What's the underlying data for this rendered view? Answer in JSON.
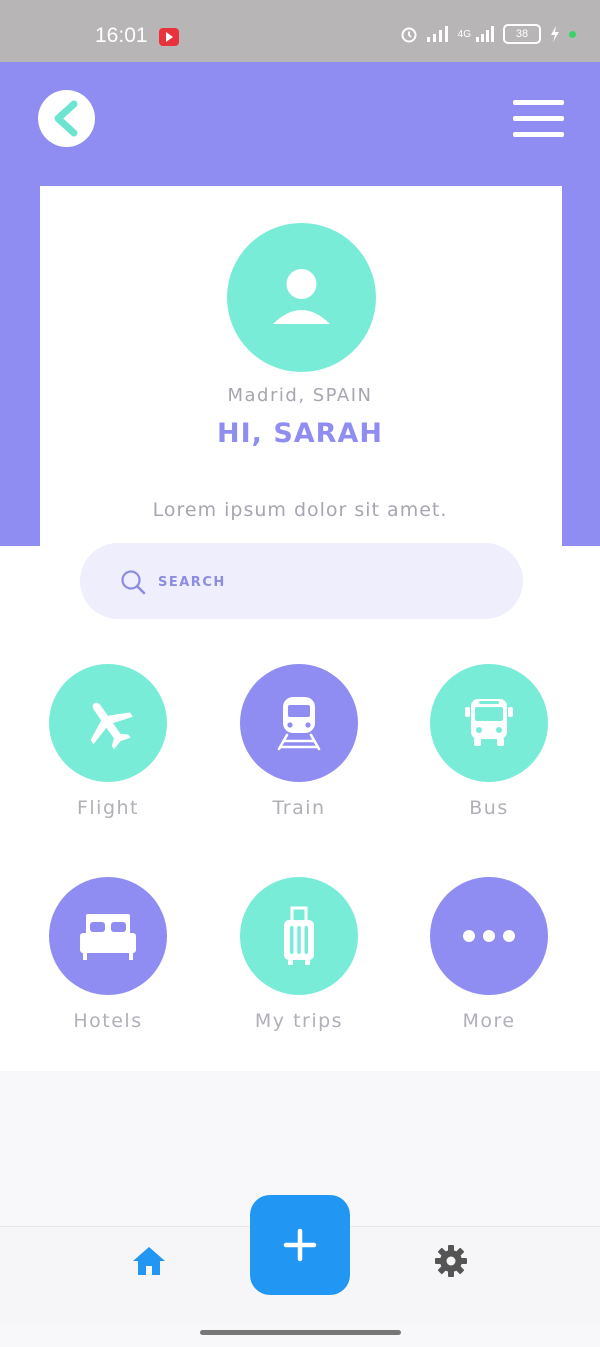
{
  "status_bar": {
    "time": "16:01",
    "network": "4G",
    "battery": "38"
  },
  "header": {
    "back_icon": "chevron-left-icon",
    "menu_icon": "hamburger-menu-icon"
  },
  "profile": {
    "avatar_icon": "user-icon",
    "location": "Madrid, SPAIN",
    "greeting": "HI, SARAH",
    "subtitle": "Lorem ipsum dolor sit amet."
  },
  "search": {
    "placeholder": "SEARCH",
    "icon": "search-icon"
  },
  "categories": [
    {
      "label": "Flight",
      "icon": "airplane-icon",
      "color": "#79ecd8"
    },
    {
      "label": "Train",
      "icon": "train-icon",
      "color": "#8f8cf2"
    },
    {
      "label": "Bus",
      "icon": "bus-icon",
      "color": "#79ecd8"
    },
    {
      "label": "Hotels",
      "icon": "bed-icon",
      "color": "#8f8cf2"
    },
    {
      "label": "My trips",
      "icon": "luggage-icon",
      "color": "#79ecd8"
    },
    {
      "label": "More",
      "icon": "more-dots-icon",
      "color": "#8f8cf2"
    }
  ],
  "bottom_nav": {
    "home_icon": "home-icon",
    "add_icon": "plus-icon",
    "settings_icon": "gear-icon"
  },
  "colors": {
    "accent": "#8f8cf2",
    "mint": "#79ecd8",
    "fab": "#2196f3"
  }
}
